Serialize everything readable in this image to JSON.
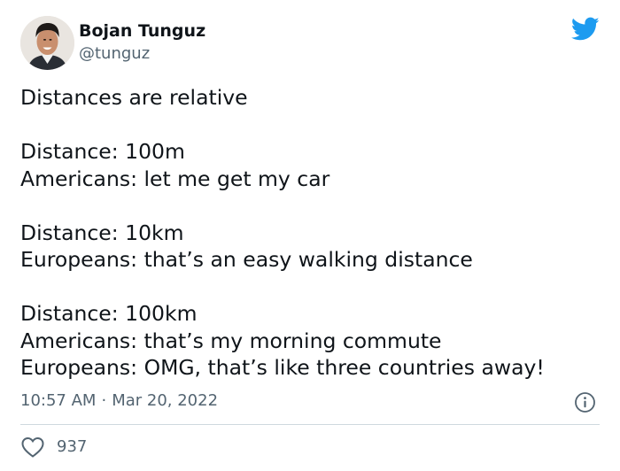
{
  "author": {
    "display_name": "Bojan Tunguz",
    "handle": "@tunguz"
  },
  "tweet": {
    "lines": [
      "Distances are relative",
      "",
      "Distance: 100m",
      "Americans: let me get my car",
      "",
      "Distance: 10km",
      "Europeans: that’s an easy walking distance",
      "",
      "Distance: 100km",
      "Americans: that’s my morning commute",
      "Europeans: OMG, that’s like three countries away!"
    ]
  },
  "meta": {
    "time": "10:57 AM",
    "separator": "·",
    "date": "Mar 20, 2022"
  },
  "actions": {
    "like_count": "937"
  },
  "icons": {
    "brand": "twitter-bird-icon",
    "info": "info-icon",
    "like": "heart-icon"
  },
  "colors": {
    "brand_blue": "#1d9bf0",
    "text_primary": "#0f1419",
    "text_secondary": "#536471",
    "divider": "#cfd9de"
  }
}
